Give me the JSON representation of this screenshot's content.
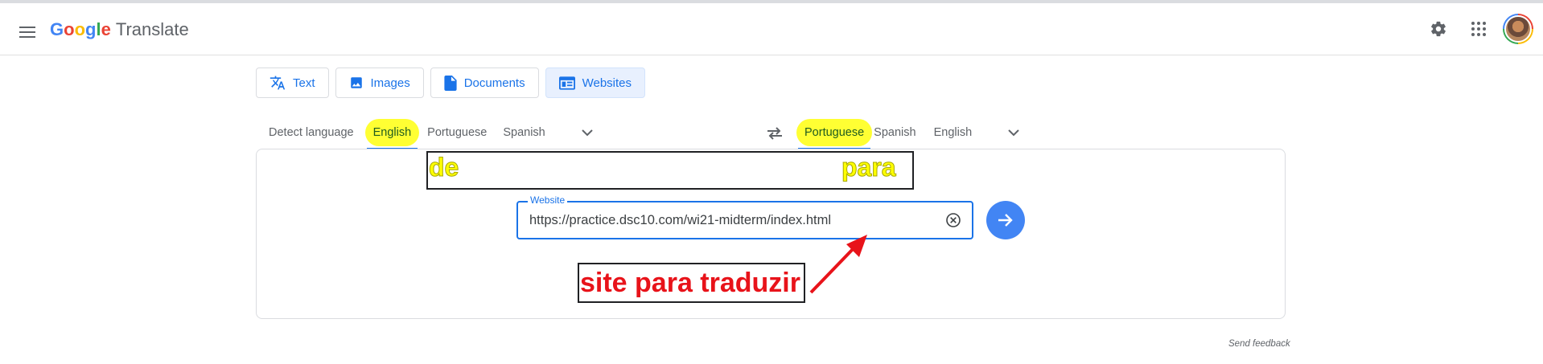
{
  "header": {
    "logo_letters": [
      "G",
      "o",
      "o",
      "g",
      "l",
      "e"
    ],
    "logo_colors": [
      "#4285f4",
      "#ea4335",
      "#fbbc05",
      "#4285f4",
      "#34a853",
      "#ea4335"
    ],
    "product_name": "Translate",
    "icons": [
      "menu-icon",
      "settings-icon",
      "apps-icon",
      "avatar"
    ]
  },
  "modes": [
    {
      "label": "Text",
      "icon": "translate-icon",
      "active": false
    },
    {
      "label": "Images",
      "icon": "image-icon",
      "active": false
    },
    {
      "label": "Documents",
      "icon": "document-icon",
      "active": false
    },
    {
      "label": "Websites",
      "icon": "website-icon",
      "active": true
    }
  ],
  "source_languages": {
    "items": [
      "Detect language",
      "English",
      "Portuguese",
      "Spanish"
    ],
    "selected": "English"
  },
  "target_languages": {
    "items": [
      "Portuguese",
      "Spanish",
      "English"
    ],
    "selected": "Portuguese"
  },
  "website_field": {
    "label": "Website",
    "value": "https://practice.dsc10.com/wi21-midterm/index.html"
  },
  "annotations": {
    "from": "de",
    "to": "para",
    "site": "site para traduzir",
    "highlight_color": "#ffff33",
    "site_color": "#e8131a"
  },
  "footer": {
    "feedback": "Send feedback"
  },
  "colors": {
    "accent": "#1a73e8",
    "go_button": "#4285f4"
  }
}
